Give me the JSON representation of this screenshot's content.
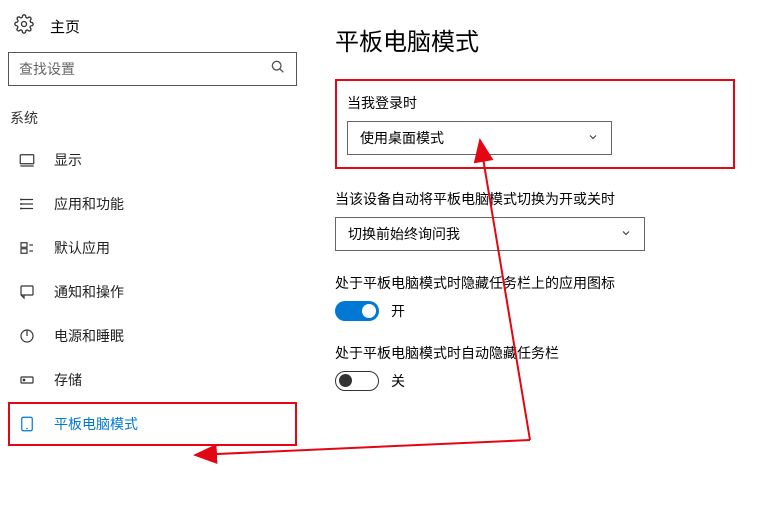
{
  "sidebar": {
    "home": "主页",
    "search_placeholder": "查找设置",
    "section": "系统",
    "items": [
      {
        "label": "显示"
      },
      {
        "label": "应用和功能"
      },
      {
        "label": "默认应用"
      },
      {
        "label": "通知和操作"
      },
      {
        "label": "电源和睡眠"
      },
      {
        "label": "存储"
      },
      {
        "label": "平板电脑模式"
      }
    ]
  },
  "content": {
    "title": "平板电脑模式",
    "login_label": "当我登录时",
    "login_value": "使用桌面模式",
    "auto_switch_label": "当该设备自动将平板电脑模式切换为开或关时",
    "auto_switch_value": "切换前始终询问我",
    "hide_icons_label": "处于平板电脑模式时隐藏任务栏上的应用图标",
    "hide_icons_state": "开",
    "auto_hide_taskbar_label": "处于平板电脑模式时自动隐藏任务栏",
    "auto_hide_taskbar_state": "关"
  }
}
